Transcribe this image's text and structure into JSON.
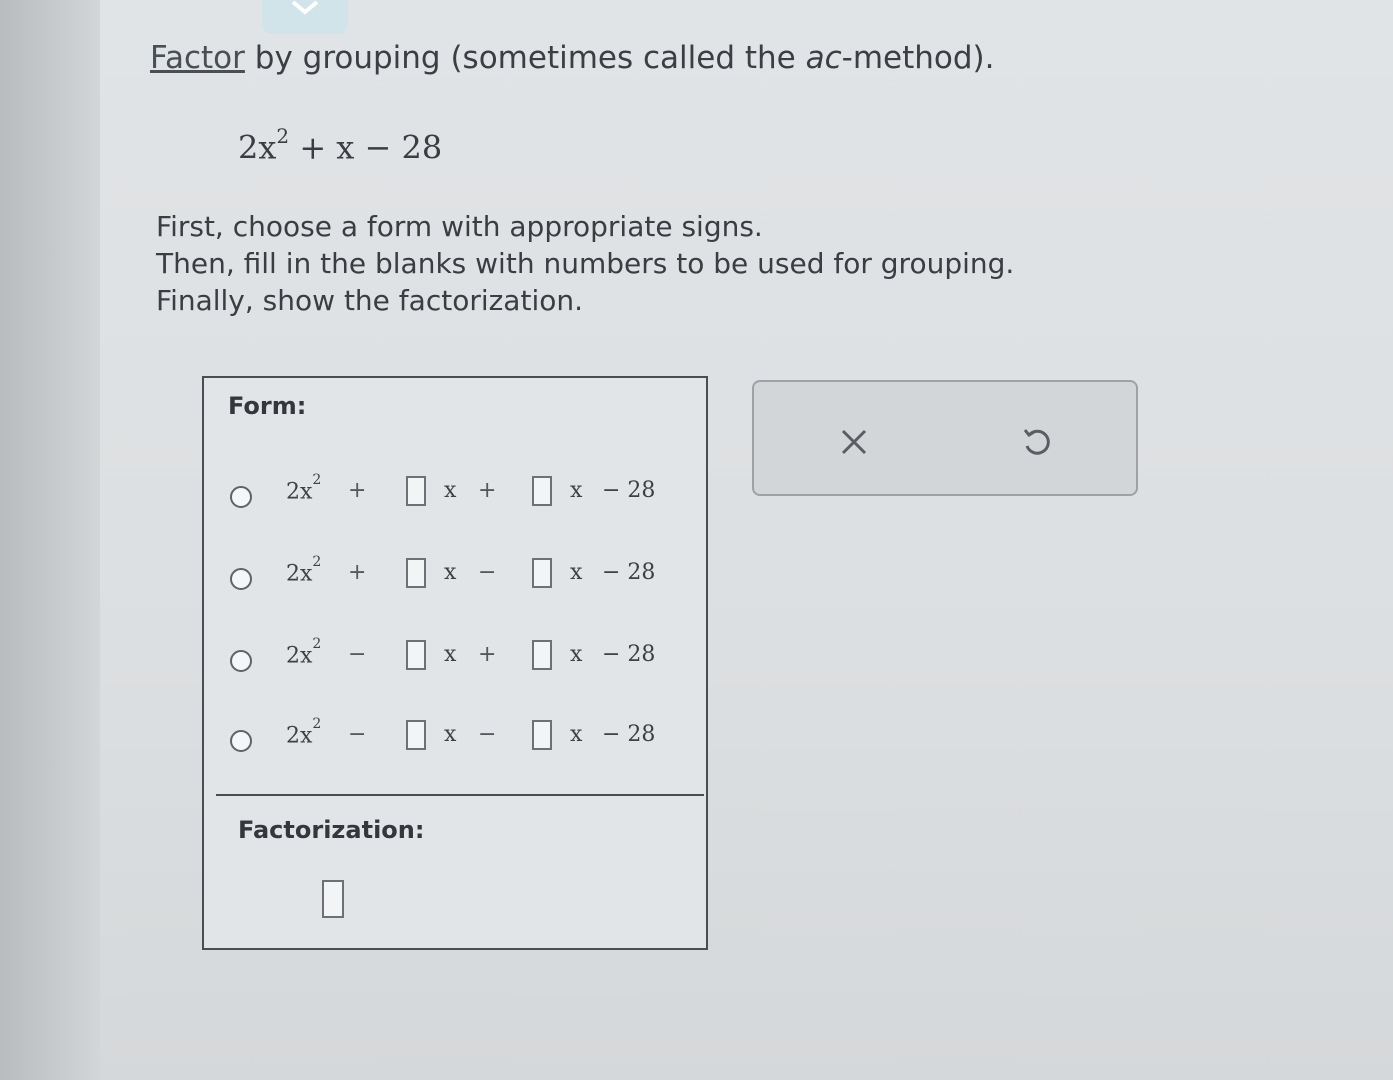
{
  "header": {
    "instruction_link": "Factor",
    "instruction_mid": " by grouping (sometimes called the ",
    "instruction_ital": "ac",
    "instruction_end": "-method)."
  },
  "expression": {
    "coef": "2x",
    "exp": "2",
    "rest": " + x − 28"
  },
  "directions": [
    "First, choose a form with appropriate signs.",
    "Then, fill in the blanks with numbers to be used for grouping.",
    "Finally, show the factorization."
  ],
  "form": {
    "label": "Form:",
    "options": [
      {
        "lead": "2x",
        "exp": "2",
        "sign1": "+",
        "var1": "x",
        "sign2": "+",
        "var2": "x",
        "tail": "− 28"
      },
      {
        "lead": "2x",
        "exp": "2",
        "sign1": "+",
        "var1": "x",
        "sign2": "−",
        "var2": "x",
        "tail": "− 28"
      },
      {
        "lead": "2x",
        "exp": "2",
        "sign1": "−",
        "var1": "x",
        "sign2": "+",
        "var2": "x",
        "tail": "− 28"
      },
      {
        "lead": "2x",
        "exp": "2",
        "sign1": "−",
        "var1": "x",
        "sign2": "−",
        "var2": "x",
        "tail": "− 28"
      }
    ]
  },
  "factorization": {
    "label": "Factorization:"
  },
  "tools": {
    "clear_icon": "close-icon",
    "undo_icon": "undo-icon"
  }
}
